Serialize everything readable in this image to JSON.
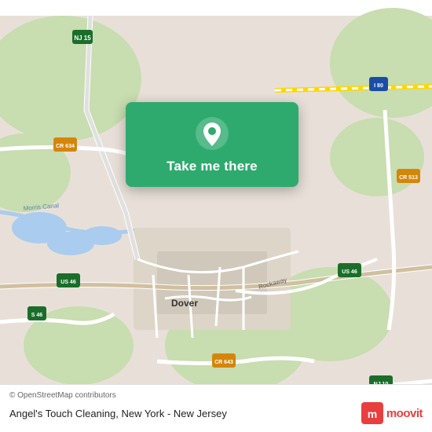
{
  "map": {
    "region": "Dover, New Jersey area",
    "copyright": "© OpenStreetMap contributors",
    "road_labels": [
      "NJ 15",
      "CR 634",
      "I 80",
      "CR 513",
      "US 46",
      "NJ 10",
      "S 46",
      "CR 643",
      "Morris Canal",
      "Dover",
      "Rockaway"
    ],
    "accent_color": "#2eaa6e"
  },
  "cta": {
    "button_label": "Take me there",
    "pin_icon": "location-pin"
  },
  "footer": {
    "copyright": "© OpenStreetMap contributors",
    "location_text": "Angel's Touch Cleaning, New York - New Jersey",
    "brand": "moovit"
  }
}
